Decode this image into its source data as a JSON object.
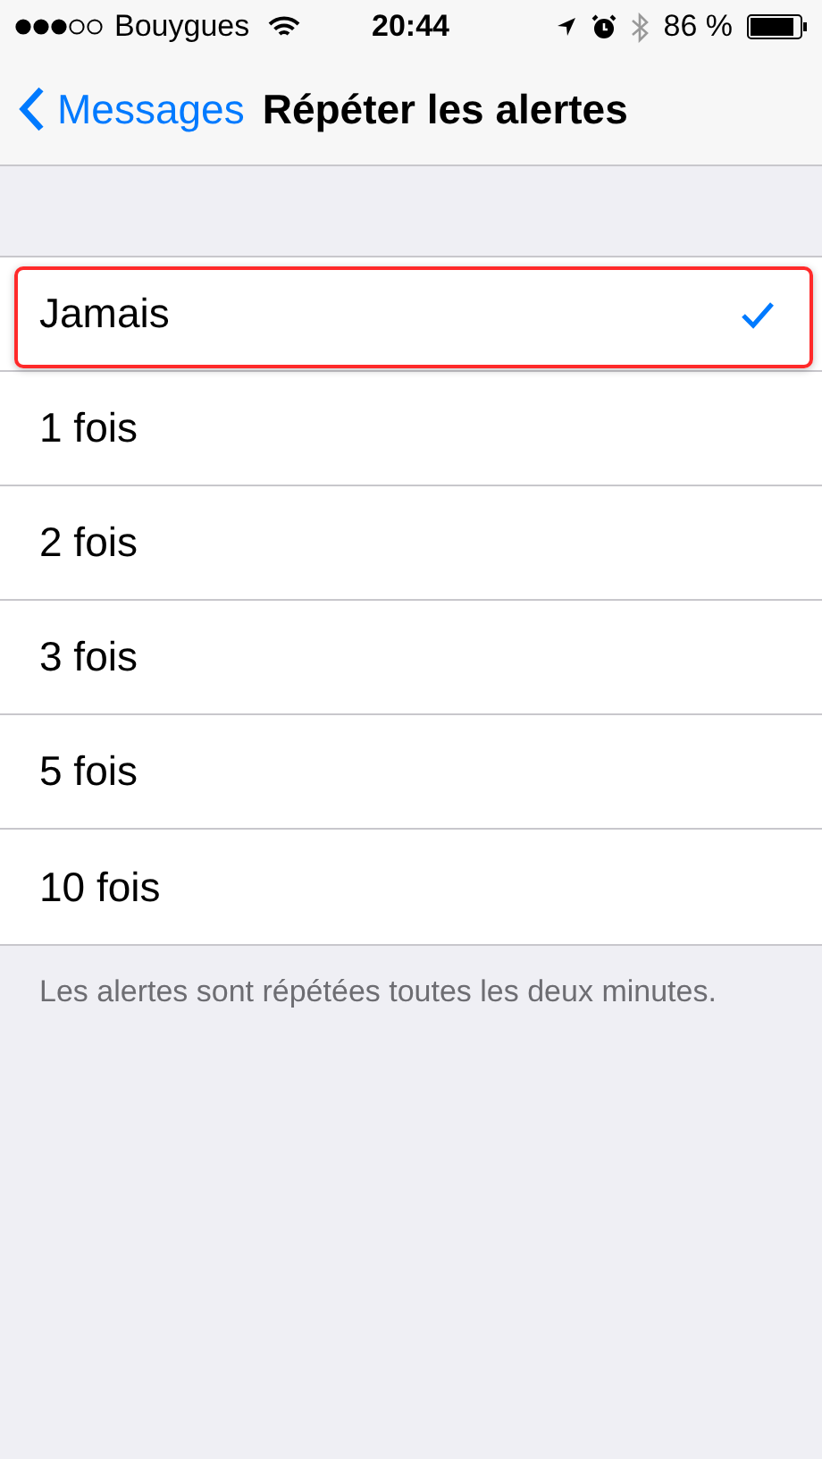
{
  "status_bar": {
    "carrier": "Bouygues",
    "time": "20:44",
    "battery": "86 %"
  },
  "nav_bar": {
    "back": "Messages",
    "title": "Répéter les alertes"
  },
  "options": [
    {
      "label": "Jamais",
      "selected": true,
      "highlighted": true
    },
    {
      "label": "1 fois",
      "selected": false,
      "highlighted": false
    },
    {
      "label": "2 fois",
      "selected": false,
      "highlighted": false
    },
    {
      "label": "3 fois",
      "selected": false,
      "highlighted": false
    },
    {
      "label": "5 fois",
      "selected": false,
      "highlighted": false
    },
    {
      "label": "10 fois",
      "selected": false,
      "highlighted": false
    }
  ],
  "footer": "Les alertes sont répétées toutes les deux minutes."
}
